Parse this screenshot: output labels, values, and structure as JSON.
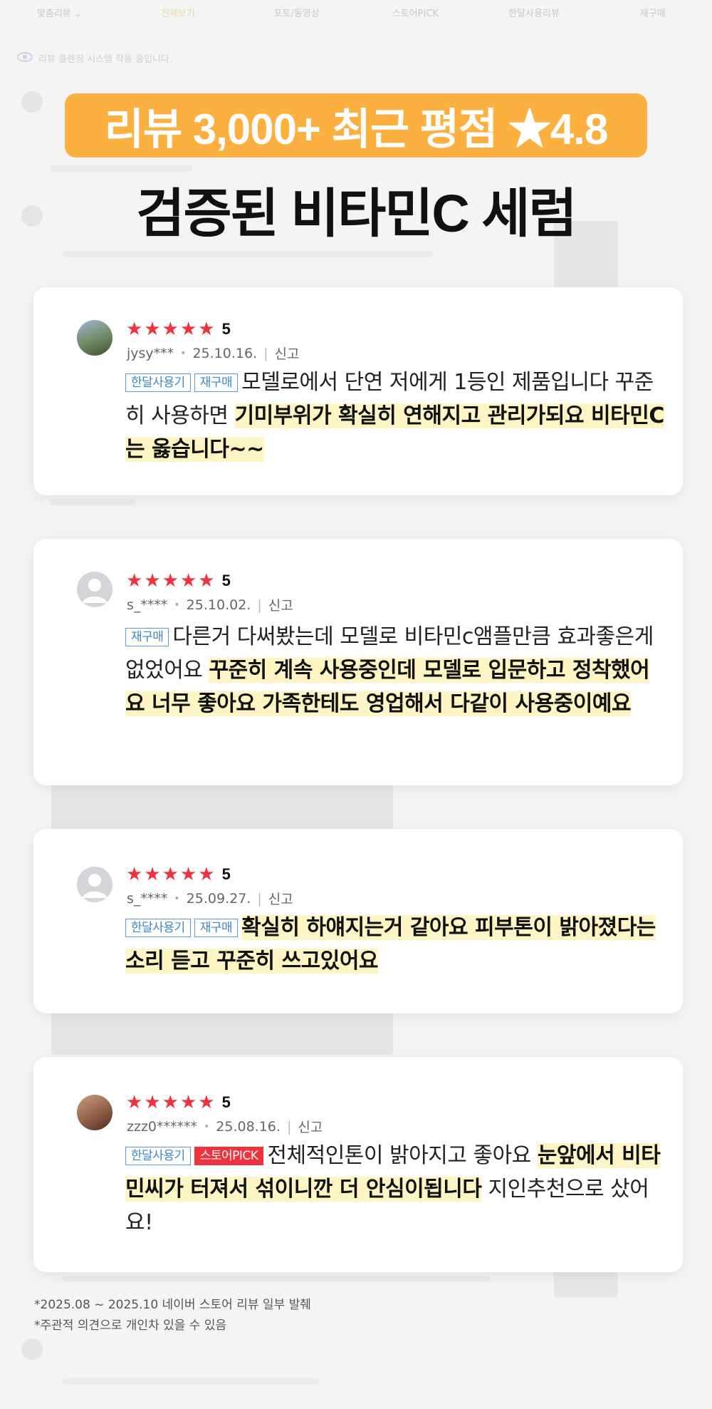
{
  "background": {
    "tabs": [
      {
        "label": "맞춤리뷰 ⌄"
      },
      {
        "label": "전체보기"
      },
      {
        "label": "포토/동영상"
      },
      {
        "label": "스토어PICK"
      },
      {
        "label": "한달사용리뷰"
      },
      {
        "label": "재구매"
      }
    ],
    "notice": "리뷰 클렌징 시스템 작동 중입니다."
  },
  "headline": {
    "badge": "리뷰 3,000+ 최근 평점 ★4.8",
    "title": "검증된 비타민C 세럼"
  },
  "reviews": [
    {
      "rating": "5",
      "user": "jysy***",
      "date": "25.10.16.",
      "report": "신고",
      "tags": [
        "한달사용기",
        "재구매"
      ],
      "text_plain": "모델로에서 단연 저에게 1등인 제품입니다 꾸준히 사용하면 ",
      "text_highlight": "기미부위가 확실히 연해지고 관리가되요 비타민C는 옳습니다~~",
      "text_after": ""
    },
    {
      "rating": "5",
      "user": "s_****",
      "date": "25.10.02.",
      "report": "신고",
      "tags": [
        "재구매"
      ],
      "text_plain": "다른거 다써봤는데 모델로 비타민c앰플만큼 효과좋은게 없었어요 ",
      "text_highlight": "꾸준히 계속 사용중인데 모델로 입문하고 정착했어요 너무 좋아요 가족한테도 영업해서 다같이 사용중이예요",
      "text_after": ""
    },
    {
      "rating": "5",
      "user": "s_****",
      "date": "25.09.27.",
      "report": "신고",
      "tags": [
        "한달사용기",
        "재구매"
      ],
      "text_plain": "",
      "text_highlight": "확실히 하얘지는거 같아요 피부톤이 밝아졌다는 소리 듣고 꾸준히 쓰고있어요",
      "text_after": ""
    },
    {
      "rating": "5",
      "user": "zzz0******",
      "date": "25.08.16.",
      "report": "신고",
      "tags": [
        "한달사용기"
      ],
      "pick_tag": "스토어PICK",
      "text_plain": "전체적인톤이 밝아지고 좋아요 ",
      "text_highlight": "눈앞에서 비타민씨가 터져서 섞이니깐 더 안심이됩니다",
      "text_after": " 지인추천으로 샀어요!"
    }
  ],
  "footnotes": [
    "*2025.08 ~ 2025.10 네이버 스토어 리뷰 일부 발췌",
    "*주관적 의견으로 개인차 있을 수 있음"
  ],
  "colors": {
    "badge": "#fbb040",
    "star": "#f0323c",
    "highlight": "#fff4c4",
    "tag_border": "#5b9bd5",
    "pick_tag": "#f0323c"
  }
}
